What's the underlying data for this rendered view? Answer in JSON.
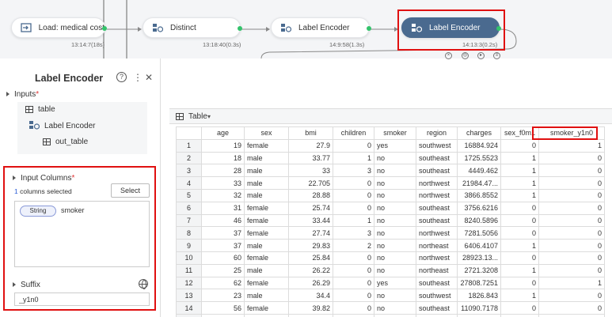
{
  "pipeline": {
    "nodes": [
      {
        "label": "Load: medical cost",
        "time": "13:14:7(18s)"
      },
      {
        "label": "Distinct",
        "time": "13:18:40(0.3s)"
      },
      {
        "label": "Label Encoder",
        "time": "14:9:58(1.3s)"
      },
      {
        "label": "Label Encoder",
        "time": "14:13:3(0.2s)"
      }
    ]
  },
  "panel": {
    "title": "Label Encoder",
    "help_icon": "?",
    "more_icon": "⋮",
    "close_icon": "✕",
    "inputs": {
      "label": "Inputs",
      "required_mark": "*",
      "table_item": "table",
      "encoder_item": "Label Encoder",
      "output_item": "out_table"
    },
    "input_columns": {
      "label": "Input Columns",
      "required_mark": "*",
      "selected_count": "1",
      "selected_text": "columns selected",
      "select_button": "Select",
      "column_type": "String",
      "column_name": "smoker"
    },
    "suffix": {
      "label": "Suffix",
      "value": "_y1n0"
    }
  },
  "table": {
    "title": "Table",
    "caret": "▾",
    "columns": [
      "",
      "age",
      "sex",
      "bmi",
      "children",
      "smoker",
      "region",
      "charges",
      "sex_f0m1",
      "smoker_y1n0"
    ],
    "rows": [
      [
        "1",
        "19",
        "female",
        "27.9",
        "0",
        "yes",
        "southwest",
        "16884.924",
        "0",
        "1"
      ],
      [
        "2",
        "18",
        "male",
        "33.77",
        "1",
        "no",
        "southeast",
        "1725.5523",
        "1",
        "0"
      ],
      [
        "3",
        "28",
        "male",
        "33",
        "3",
        "no",
        "southeast",
        "4449.462",
        "1",
        "0"
      ],
      [
        "4",
        "33",
        "male",
        "22.705",
        "0",
        "no",
        "northwest",
        "21984.47...",
        "1",
        "0"
      ],
      [
        "5",
        "32",
        "male",
        "28.88",
        "0",
        "no",
        "northwest",
        "3866.8552",
        "1",
        "0"
      ],
      [
        "6",
        "31",
        "female",
        "25.74",
        "0",
        "no",
        "southeast",
        "3756.6216",
        "0",
        "0"
      ],
      [
        "7",
        "46",
        "female",
        "33.44",
        "1",
        "no",
        "southeast",
        "8240.5896",
        "0",
        "0"
      ],
      [
        "8",
        "37",
        "female",
        "27.74",
        "3",
        "no",
        "northwest",
        "7281.5056",
        "0",
        "0"
      ],
      [
        "9",
        "37",
        "male",
        "29.83",
        "2",
        "no",
        "northeast",
        "6406.4107",
        "1",
        "0"
      ],
      [
        "10",
        "60",
        "female",
        "25.84",
        "0",
        "no",
        "northwest",
        "28923.13...",
        "0",
        "0"
      ],
      [
        "11",
        "25",
        "male",
        "26.22",
        "0",
        "no",
        "northeast",
        "2721.3208",
        "1",
        "0"
      ],
      [
        "12",
        "62",
        "female",
        "26.29",
        "0",
        "yes",
        "southeast",
        "27808.7251",
        "0",
        "1"
      ],
      [
        "13",
        "23",
        "male",
        "34.4",
        "0",
        "no",
        "southwest",
        "1826.843",
        "1",
        "0"
      ],
      [
        "14",
        "56",
        "female",
        "39.82",
        "0",
        "no",
        "southeast",
        "11090.7178",
        "0",
        "0"
      ],
      [
        "15",
        "27",
        "male",
        "42.13",
        "0",
        "yes",
        "southeast",
        "39611.7577",
        "1",
        "1"
      ]
    ]
  }
}
